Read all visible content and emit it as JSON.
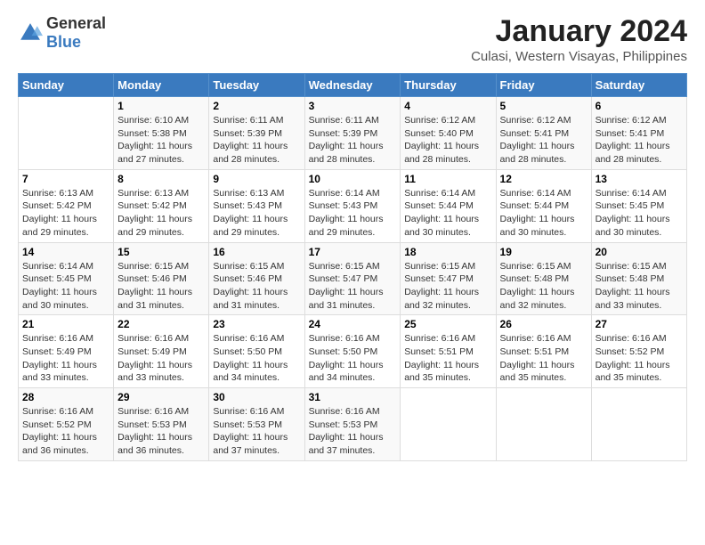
{
  "header": {
    "logo": {
      "general": "General",
      "blue": "Blue"
    },
    "title": "January 2024",
    "subtitle": "Culasi, Western Visayas, Philippines"
  },
  "calendar": {
    "days_of_week": [
      "Sunday",
      "Monday",
      "Tuesday",
      "Wednesday",
      "Thursday",
      "Friday",
      "Saturday"
    ],
    "weeks": [
      [
        {
          "day": "",
          "info": ""
        },
        {
          "day": "1",
          "info": "Sunrise: 6:10 AM\nSunset: 5:38 PM\nDaylight: 11 hours\nand 27 minutes."
        },
        {
          "day": "2",
          "info": "Sunrise: 6:11 AM\nSunset: 5:39 PM\nDaylight: 11 hours\nand 28 minutes."
        },
        {
          "day": "3",
          "info": "Sunrise: 6:11 AM\nSunset: 5:39 PM\nDaylight: 11 hours\nand 28 minutes."
        },
        {
          "day": "4",
          "info": "Sunrise: 6:12 AM\nSunset: 5:40 PM\nDaylight: 11 hours\nand 28 minutes."
        },
        {
          "day": "5",
          "info": "Sunrise: 6:12 AM\nSunset: 5:41 PM\nDaylight: 11 hours\nand 28 minutes."
        },
        {
          "day": "6",
          "info": "Sunrise: 6:12 AM\nSunset: 5:41 PM\nDaylight: 11 hours\nand 28 minutes."
        }
      ],
      [
        {
          "day": "7",
          "info": "Sunrise: 6:13 AM\nSunset: 5:42 PM\nDaylight: 11 hours\nand 29 minutes."
        },
        {
          "day": "8",
          "info": "Sunrise: 6:13 AM\nSunset: 5:42 PM\nDaylight: 11 hours\nand 29 minutes."
        },
        {
          "day": "9",
          "info": "Sunrise: 6:13 AM\nSunset: 5:43 PM\nDaylight: 11 hours\nand 29 minutes."
        },
        {
          "day": "10",
          "info": "Sunrise: 6:14 AM\nSunset: 5:43 PM\nDaylight: 11 hours\nand 29 minutes."
        },
        {
          "day": "11",
          "info": "Sunrise: 6:14 AM\nSunset: 5:44 PM\nDaylight: 11 hours\nand 30 minutes."
        },
        {
          "day": "12",
          "info": "Sunrise: 6:14 AM\nSunset: 5:44 PM\nDaylight: 11 hours\nand 30 minutes."
        },
        {
          "day": "13",
          "info": "Sunrise: 6:14 AM\nSunset: 5:45 PM\nDaylight: 11 hours\nand 30 minutes."
        }
      ],
      [
        {
          "day": "14",
          "info": "Sunrise: 6:14 AM\nSunset: 5:45 PM\nDaylight: 11 hours\nand 30 minutes."
        },
        {
          "day": "15",
          "info": "Sunrise: 6:15 AM\nSunset: 5:46 PM\nDaylight: 11 hours\nand 31 minutes."
        },
        {
          "day": "16",
          "info": "Sunrise: 6:15 AM\nSunset: 5:46 PM\nDaylight: 11 hours\nand 31 minutes."
        },
        {
          "day": "17",
          "info": "Sunrise: 6:15 AM\nSunset: 5:47 PM\nDaylight: 11 hours\nand 31 minutes."
        },
        {
          "day": "18",
          "info": "Sunrise: 6:15 AM\nSunset: 5:47 PM\nDaylight: 11 hours\nand 32 minutes."
        },
        {
          "day": "19",
          "info": "Sunrise: 6:15 AM\nSunset: 5:48 PM\nDaylight: 11 hours\nand 32 minutes."
        },
        {
          "day": "20",
          "info": "Sunrise: 6:15 AM\nSunset: 5:48 PM\nDaylight: 11 hours\nand 33 minutes."
        }
      ],
      [
        {
          "day": "21",
          "info": "Sunrise: 6:16 AM\nSunset: 5:49 PM\nDaylight: 11 hours\nand 33 minutes."
        },
        {
          "day": "22",
          "info": "Sunrise: 6:16 AM\nSunset: 5:49 PM\nDaylight: 11 hours\nand 33 minutes."
        },
        {
          "day": "23",
          "info": "Sunrise: 6:16 AM\nSunset: 5:50 PM\nDaylight: 11 hours\nand 34 minutes."
        },
        {
          "day": "24",
          "info": "Sunrise: 6:16 AM\nSunset: 5:50 PM\nDaylight: 11 hours\nand 34 minutes."
        },
        {
          "day": "25",
          "info": "Sunrise: 6:16 AM\nSunset: 5:51 PM\nDaylight: 11 hours\nand 35 minutes."
        },
        {
          "day": "26",
          "info": "Sunrise: 6:16 AM\nSunset: 5:51 PM\nDaylight: 11 hours\nand 35 minutes."
        },
        {
          "day": "27",
          "info": "Sunrise: 6:16 AM\nSunset: 5:52 PM\nDaylight: 11 hours\nand 35 minutes."
        }
      ],
      [
        {
          "day": "28",
          "info": "Sunrise: 6:16 AM\nSunset: 5:52 PM\nDaylight: 11 hours\nand 36 minutes."
        },
        {
          "day": "29",
          "info": "Sunrise: 6:16 AM\nSunset: 5:53 PM\nDaylight: 11 hours\nand 36 minutes."
        },
        {
          "day": "30",
          "info": "Sunrise: 6:16 AM\nSunset: 5:53 PM\nDaylight: 11 hours\nand 37 minutes."
        },
        {
          "day": "31",
          "info": "Sunrise: 6:16 AM\nSunset: 5:53 PM\nDaylight: 11 hours\nand 37 minutes."
        },
        {
          "day": "",
          "info": ""
        },
        {
          "day": "",
          "info": ""
        },
        {
          "day": "",
          "info": ""
        }
      ]
    ]
  }
}
